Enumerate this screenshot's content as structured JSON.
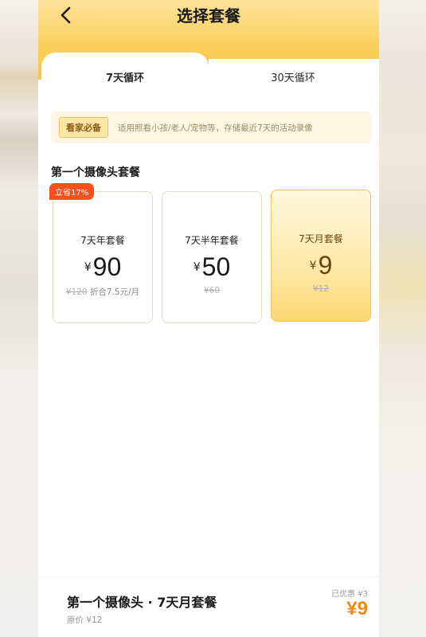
{
  "header": {
    "title": "选择套餐"
  },
  "tabs": [
    {
      "label": "7天循环",
      "active": true
    },
    {
      "label": "30天循环",
      "active": false
    }
  ],
  "notice": {
    "badge": "看家必备",
    "text": "适用照看小孩/老人/宠物等，存储最近7天的活动录像"
  },
  "section": {
    "title": "第一个摄像头套餐"
  },
  "plans": [
    {
      "name": "7天年套餐",
      "currency": "¥",
      "price": "90",
      "original": "¥120",
      "note": "折合7.5元/月",
      "badge": "立省17%",
      "selected": false
    },
    {
      "name": "7天半年套餐",
      "currency": "¥",
      "price": "50",
      "original": "¥60",
      "note": "",
      "badge": "",
      "selected": false
    },
    {
      "name": "7天月套餐",
      "currency": "¥",
      "price": "9",
      "original": "¥12",
      "note": "",
      "badge": "",
      "selected": true
    }
  ],
  "footer": {
    "title": "第一个摄像头 · 7天月套餐",
    "original": "原价 ¥12",
    "discount": "已优惠 ¥3",
    "price": "¥9"
  },
  "colors": {
    "header_gradient_start": "#fde39a",
    "header_gradient_end": "#f9c84a",
    "accent_orange": "#f08a17",
    "save_badge": "#f4511e",
    "selected_card": "#fde9a8"
  }
}
